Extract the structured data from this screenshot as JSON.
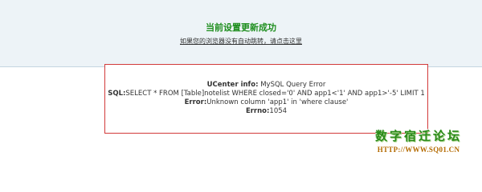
{
  "message": {
    "title": "当前设置更新成功",
    "redirect_link": "如果您的浏览器没有自动跳转，请点击这里"
  },
  "error": {
    "info_label": "UCenter info:",
    "info_value": " MySQL Query Error",
    "sql_label": "SQL:",
    "sql_value": "SELECT * FROM [Table]notelist WHERE closed='0' AND app1<'1' AND app1>'-5' LIMIT 1",
    "error_label": "Error:",
    "error_value": "Unknown column 'app1' in 'where clause'",
    "errno_label": "Errno:",
    "errno_value": "1054"
  },
  "watermark": {
    "logo_text": "数字宿迁论坛",
    "url": "HTTP://WWW.SQ01.CN"
  },
  "colors": {
    "panel_bg": "#edf3f7",
    "success_green": "#1e8e1e",
    "error_border": "#d23a3a",
    "watermark_green": "#2a8a1a",
    "watermark_orange": "#b36a00"
  }
}
